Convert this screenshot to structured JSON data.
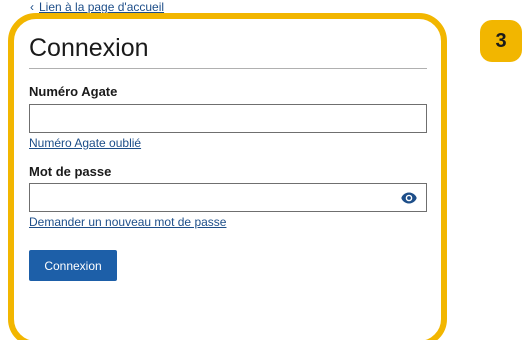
{
  "nav": {
    "back_link": "Lien à la page d'accueil",
    "back_icon": "chevron-left-icon"
  },
  "step_badge": "3",
  "form": {
    "title": "Connexion",
    "agate_label": "Numéro Agate",
    "agate_value": "",
    "agate_forgot_link": "Numéro Agate oublié",
    "password_label": "Mot de passe",
    "password_value": "",
    "password_reset_link": "Demander un nouveau mot de passe",
    "show_password_icon": "eye-icon",
    "submit_label": "Connexion"
  },
  "colors": {
    "highlight": "#f2b600",
    "link": "#1d4e89",
    "button": "#1d5fa8"
  }
}
